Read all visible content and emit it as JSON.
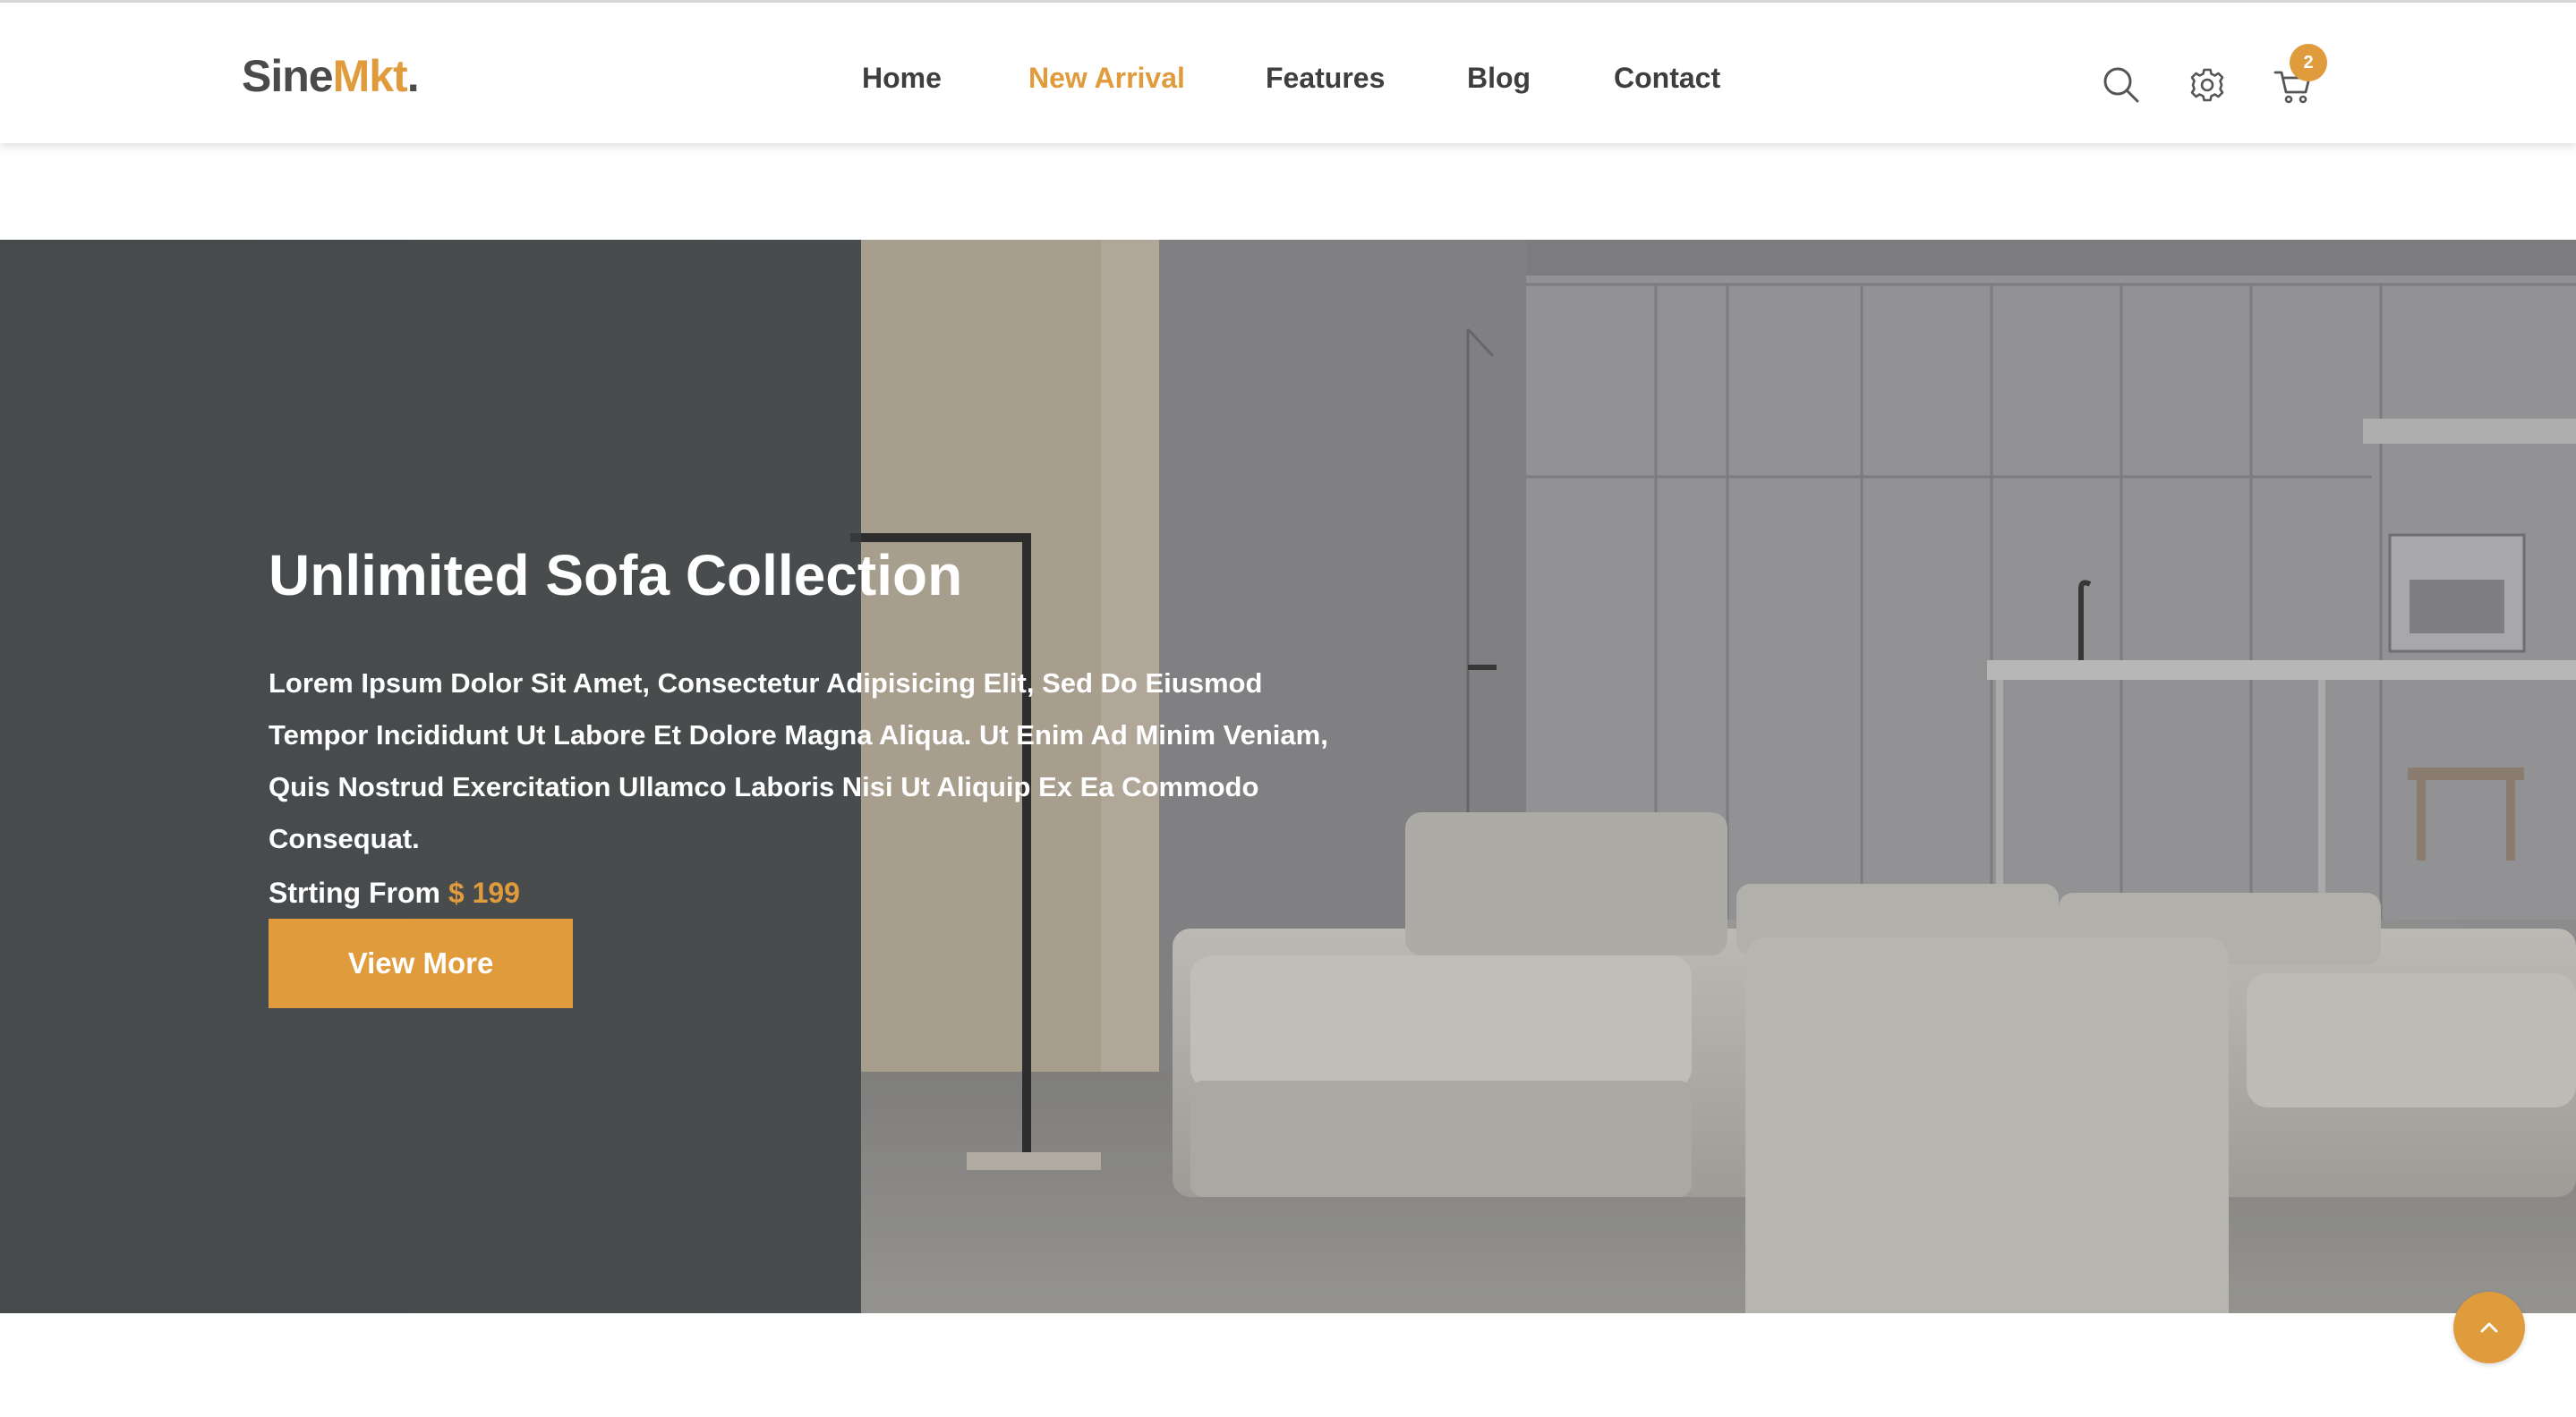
{
  "header": {
    "logo": {
      "part1": "Sine",
      "part2": "Mkt",
      "dot": "."
    },
    "nav": [
      {
        "label": "Home",
        "active": false
      },
      {
        "label": "New Arrival",
        "active": true
      },
      {
        "label": "Features",
        "active": false
      },
      {
        "label": "Blog",
        "active": false
      },
      {
        "label": "Contact",
        "active": false
      }
    ],
    "icons": [
      "search-icon",
      "gear-icon",
      "cart-icon"
    ],
    "cart_count": "2"
  },
  "hero": {
    "title": "Unlimited Sofa Collection",
    "description": "Lorem Ipsum Dolor Sit Amet, Consectetur Adipisicing Elit, Sed Do Eiusmod Tempor Incididunt Ut Labore Et Dolore Magna Aliqua. Ut Enim Ad Minim Veniam, Quis Nostrud Exercitation Ullamco Laboris Nisi Ut Aliquip Ex Ea Commodo Consequat.",
    "price_prefix": "Strting From",
    "price_amount": "$ 199",
    "button_label": "View More"
  },
  "colors": {
    "accent": "#e09b3d",
    "dark_overlay": "#373d40",
    "text_dark": "#3e3e3e"
  }
}
